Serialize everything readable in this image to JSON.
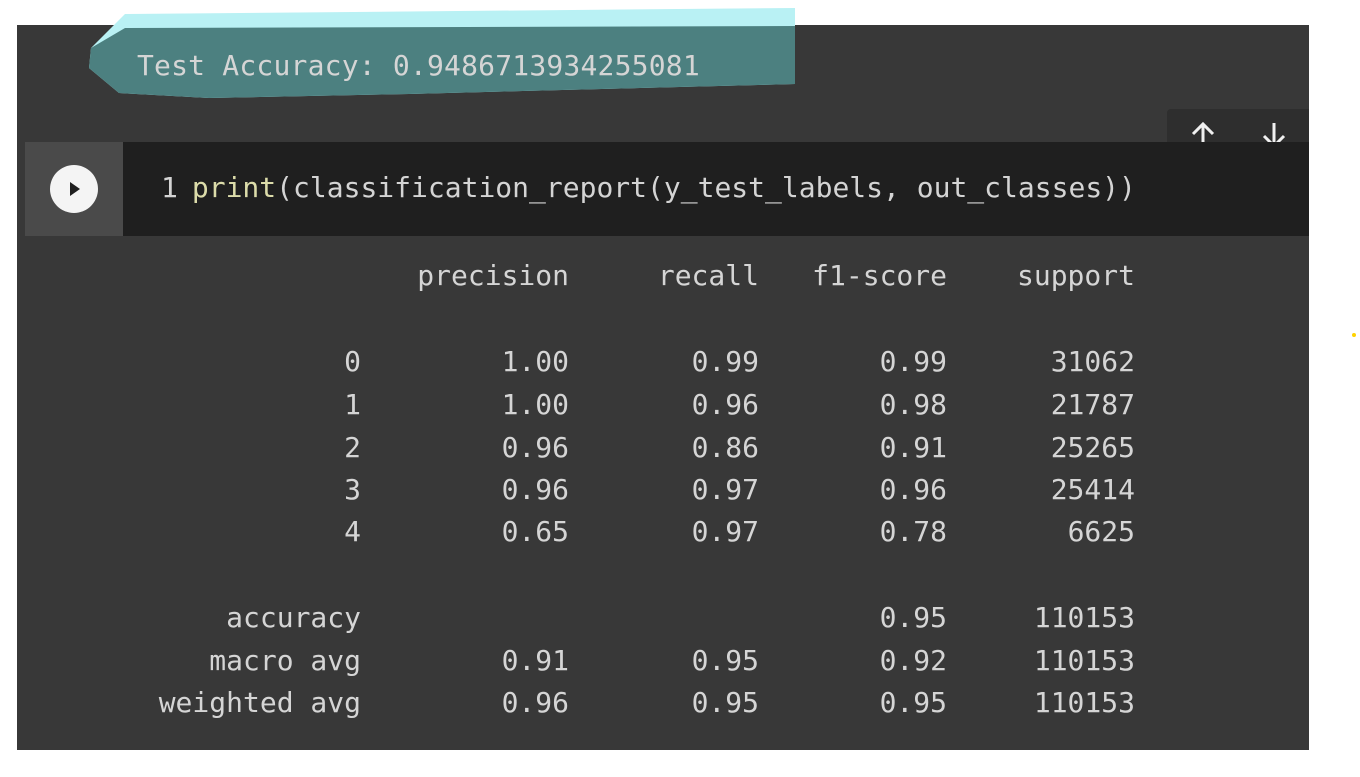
{
  "output_top": {
    "accuracy_line": "Test Accuracy: 0.9486713934255081"
  },
  "nav": {
    "up": "↑",
    "down": "↓"
  },
  "code_cell": {
    "line_number": "1",
    "fn": "print",
    "code_rest": "(classification_report(y_test_labels, out_classes))"
  },
  "report": {
    "headers": [
      "precision",
      "recall",
      "f1-score",
      "support"
    ],
    "rows": [
      {
        "label": "0",
        "precision": "1.00",
        "recall": "0.99",
        "f1": "0.99",
        "support": "31062"
      },
      {
        "label": "1",
        "precision": "1.00",
        "recall": "0.96",
        "f1": "0.98",
        "support": "21787"
      },
      {
        "label": "2",
        "precision": "0.96",
        "recall": "0.86",
        "f1": "0.91",
        "support": "25265"
      },
      {
        "label": "3",
        "precision": "0.96",
        "recall": "0.97",
        "f1": "0.96",
        "support": "25414"
      },
      {
        "label": "4",
        "precision": "0.65",
        "recall": "0.97",
        "f1": "0.78",
        "support": "6625"
      }
    ],
    "summary": [
      {
        "label": "accuracy",
        "precision": "",
        "recall": "",
        "f1": "0.95",
        "support": "110153"
      },
      {
        "label": "macro avg",
        "precision": "0.91",
        "recall": "0.95",
        "f1": "0.92",
        "support": "110153"
      },
      {
        "label": "weighted avg",
        "precision": "0.96",
        "recall": "0.95",
        "f1": "0.95",
        "support": "110153"
      }
    ]
  },
  "colors": {
    "highlight": "#3f7c7c",
    "highlight_edge": "#b9f1f4",
    "code_bg": "#1f1f1f",
    "cell_bg": "#383838"
  }
}
